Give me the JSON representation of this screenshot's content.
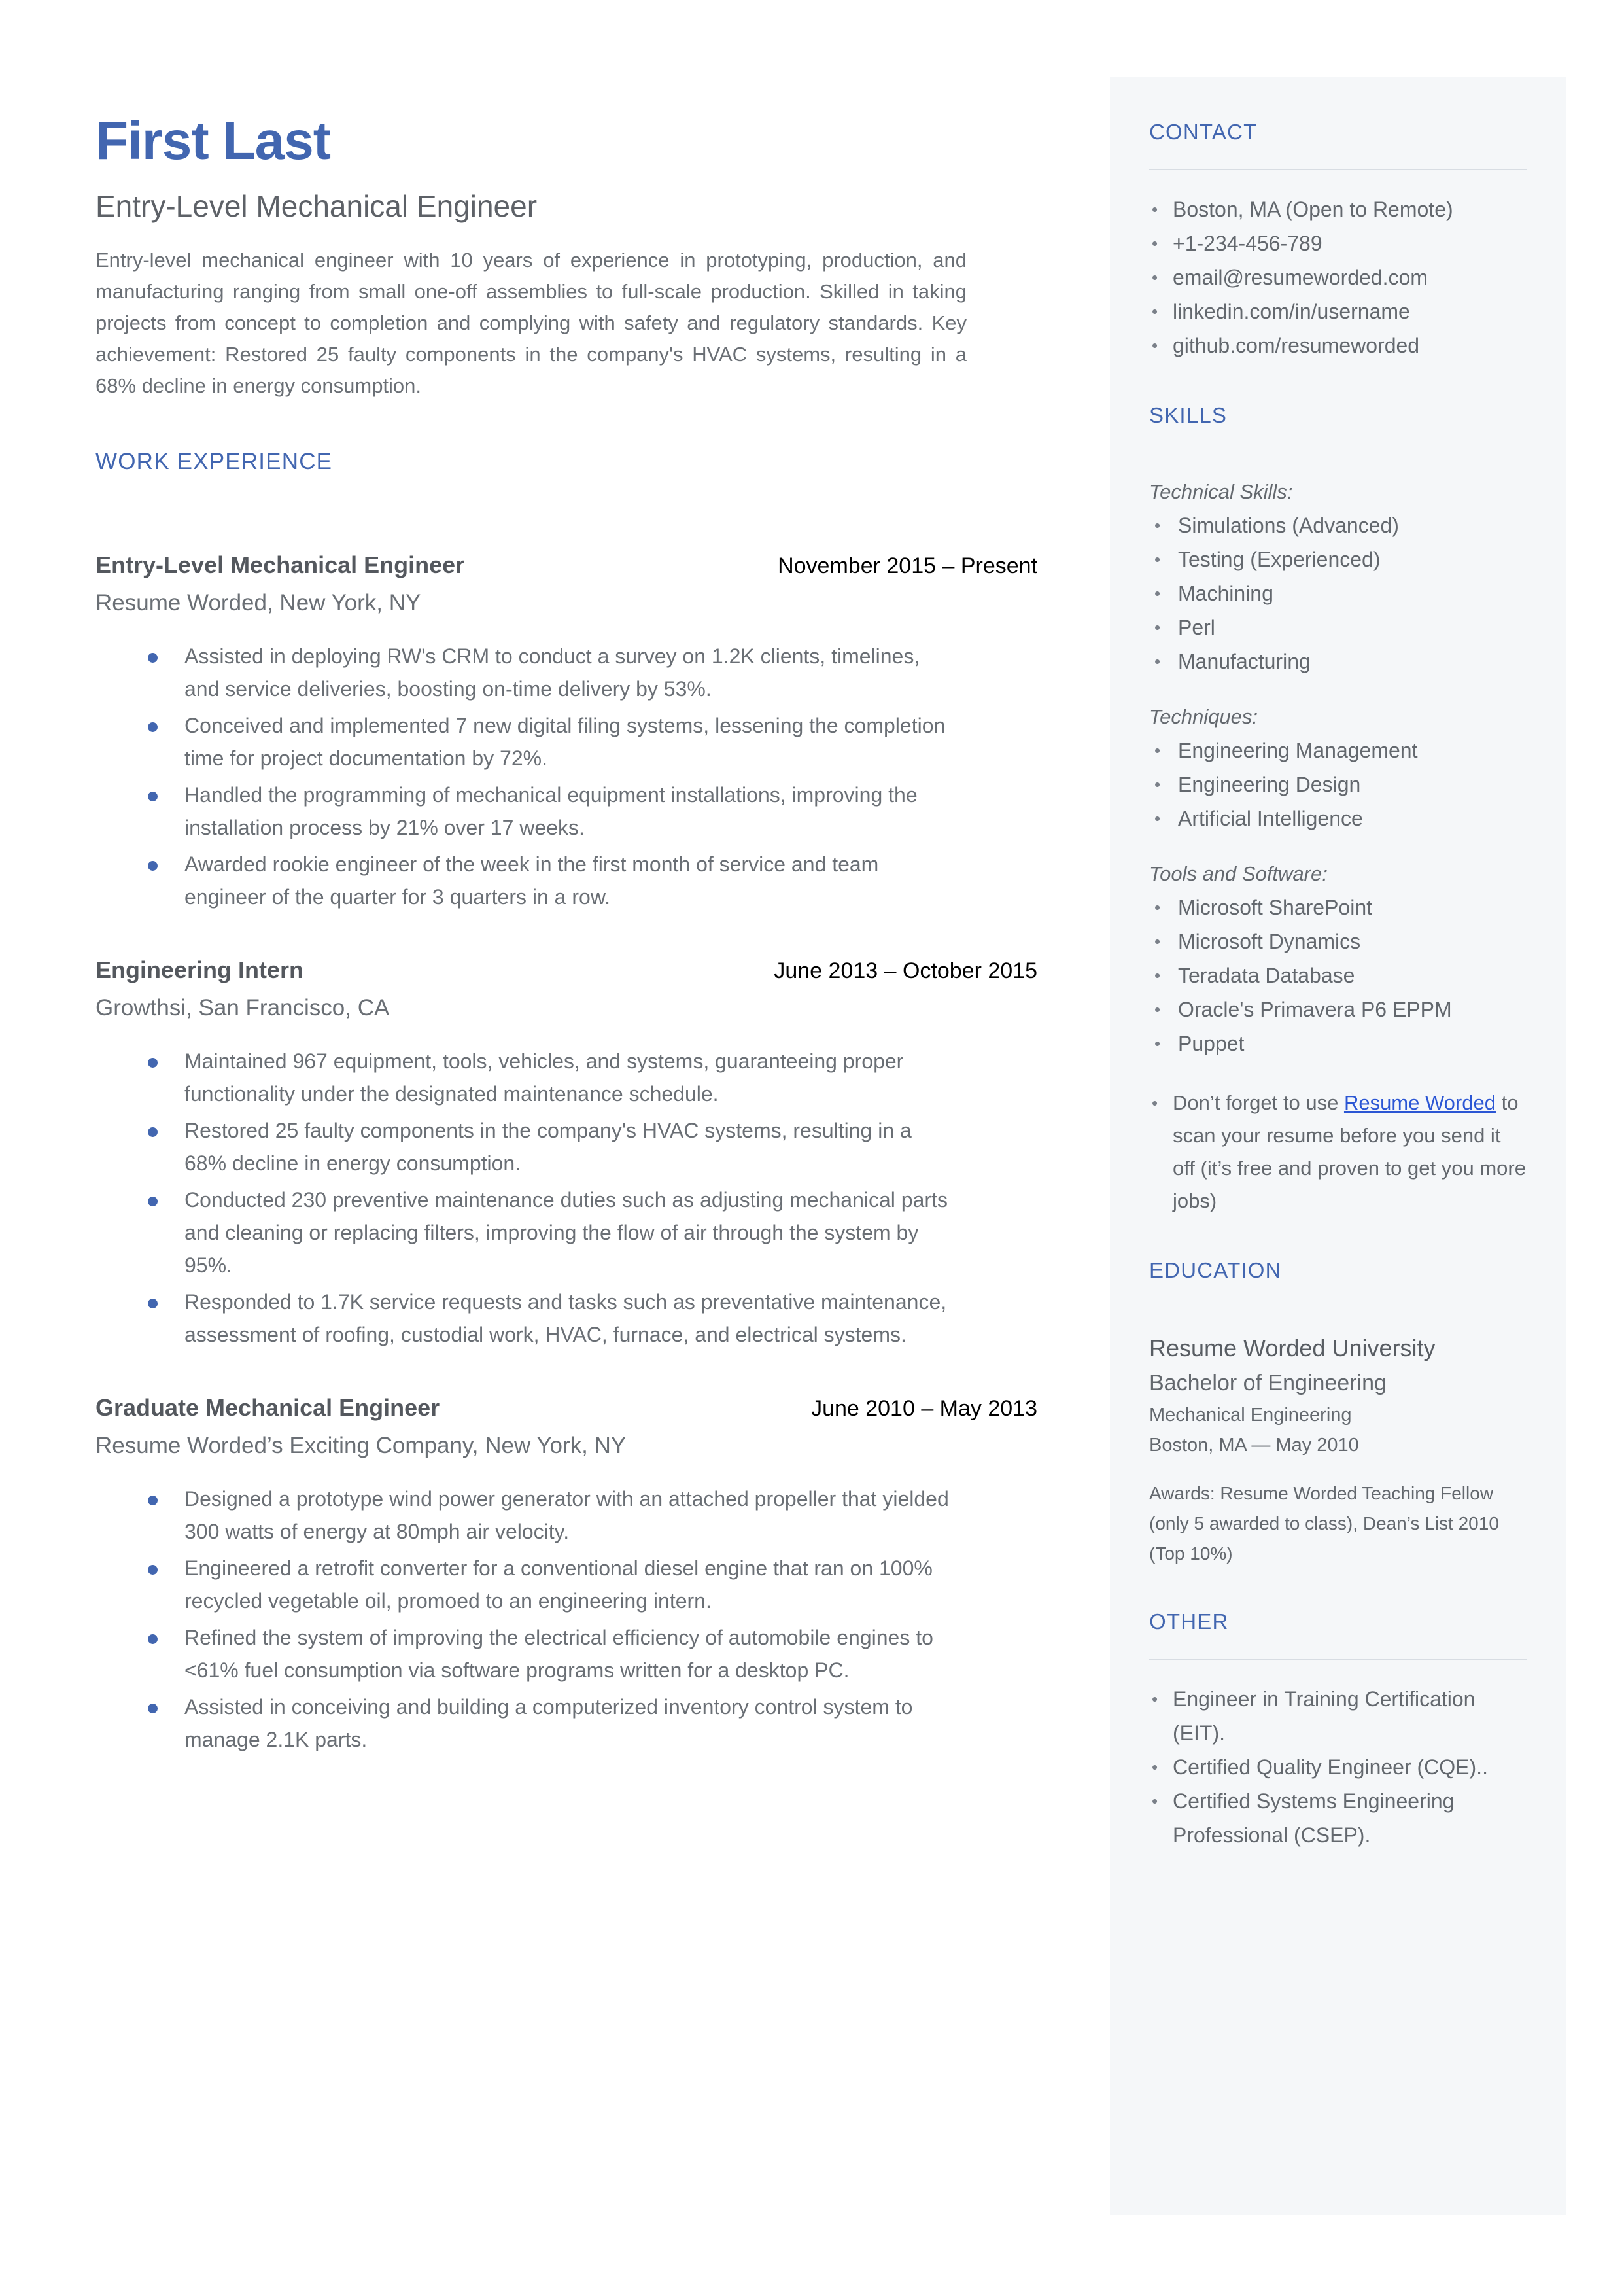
{
  "colors": {
    "accent_blue": "#4266b0",
    "link_blue": "#2b56d4",
    "sidebar_bg": "#f5f7f9",
    "body_text": "#6a6f75",
    "date_text": "#000000"
  },
  "header": {
    "name": "First Last",
    "headline": "Entry-Level Mechanical Engineer",
    "summary": "Entry-level mechanical engineer with 10 years of experience in prototyping, production, and manufacturing ranging from small one-off assemblies to full-scale production. Skilled in taking projects from concept to completion and complying with safety and regulatory standards. Key achievement: Restored 25 faulty components in the company's HVAC systems, resulting in a 68% decline in energy consumption."
  },
  "work_experience": {
    "heading": "WORK EXPERIENCE",
    "jobs": [
      {
        "role": "Entry-Level Mechanical Engineer",
        "dates": "November 2015 – Present",
        "company": "Resume Worded, New York, NY",
        "bullets": [
          "Assisted in deploying RW's CRM to conduct a survey on 1.2K clients, timelines, and service deliveries, boosting on-time delivery by 53%.",
          "Conceived and implemented 7 new digital filing systems, lessening the completion time for project documentation by 72%.",
          "Handled the programming of mechanical equipment installations, improving the installation process by 21% over 17 weeks.",
          "Awarded rookie engineer of the week in the first month of service and team engineer of the quarter for 3 quarters in a row."
        ]
      },
      {
        "role": "Engineering Intern",
        "dates": "June 2013 – October 2015",
        "company": "Growthsi, San Francisco, CA",
        "bullets": [
          "Maintained 967 equipment, tools, vehicles, and systems, guaranteeing proper functionality under the designated maintenance schedule.",
          "Restored 25 faulty components in the company's HVAC systems, resulting in a 68% decline in energy consumption.",
          "Conducted 230 preventive maintenance duties such as adjusting mechanical parts and cleaning or replacing filters, improving the flow of air through the system by 95%.",
          "Responded to 1.7K service requests and tasks such as preventative maintenance, assessment of roofing, custodial work, HVAC, furnace, and electrical systems."
        ]
      },
      {
        "role": "Graduate Mechanical Engineer",
        "dates": "June 2010 – May 2013",
        "company": "Resume Worded’s Exciting Company, New York, NY",
        "bullets": [
          "Designed a prototype wind power generator with an attached propeller that yielded 300 watts of energy at 80mph air velocity.",
          "Engineered a retrofit converter for a conventional diesel engine that ran on 100% recycled vegetable oil, promoed to an engineering intern.",
          "Refined the system of improving the electrical efficiency of automobile engines to <61% fuel consumption via software programs written for a desktop PC.",
          "Assisted in conceiving and building a computerized inventory control system to manage 2.1K parts."
        ]
      }
    ]
  },
  "sidebar": {
    "contact": {
      "heading": "CONTACT",
      "items": [
        " Boston, MA (Open to Remote)",
        "+1-234-456-789",
        "email@resumeworded.com",
        "linkedin.com/in/username",
        "github.com/resumeworded"
      ]
    },
    "skills": {
      "heading": "SKILLS",
      "groups": [
        {
          "label": "Technical Skills:",
          "items": [
            "Simulations (Advanced)",
            "Testing (Experienced)",
            "Machining",
            "Perl",
            "Manufacturing"
          ]
        },
        {
          "label": "Techniques:",
          "items": [
            "Engineering Management",
            "Engineering Design",
            "Artificial Intelligence"
          ]
        },
        {
          "label": "Tools and Software:",
          "items": [
            "Microsoft SharePoint",
            "Microsoft Dynamics",
            "Teradata Database",
            "Oracle's Primavera P6 EPPM",
            "Puppet"
          ]
        }
      ],
      "promo": {
        "prefix": "Don’t forget to use ",
        "link": "Resume Worded",
        "suffix": " to scan your resume before you send it off (it’s free and proven to get you more jobs)"
      }
    },
    "education": {
      "heading": "EDUCATION",
      "school": "Resume Worded University",
      "degree": "Bachelor of Engineering",
      "field": "Mechanical Engineering",
      "place_date": "Boston, MA — May 2010",
      "awards": "Awards: Resume Worded Teaching Fellow (only 5 awarded to class), Dean’s List 2010 (Top 10%)"
    },
    "other": {
      "heading": "OTHER",
      "items": [
        " Engineer in Training Certification (EIT).",
        "Certified Quality Engineer (CQE)..",
        "Certified Systems Engineering Professional (CSEP)."
      ]
    }
  }
}
